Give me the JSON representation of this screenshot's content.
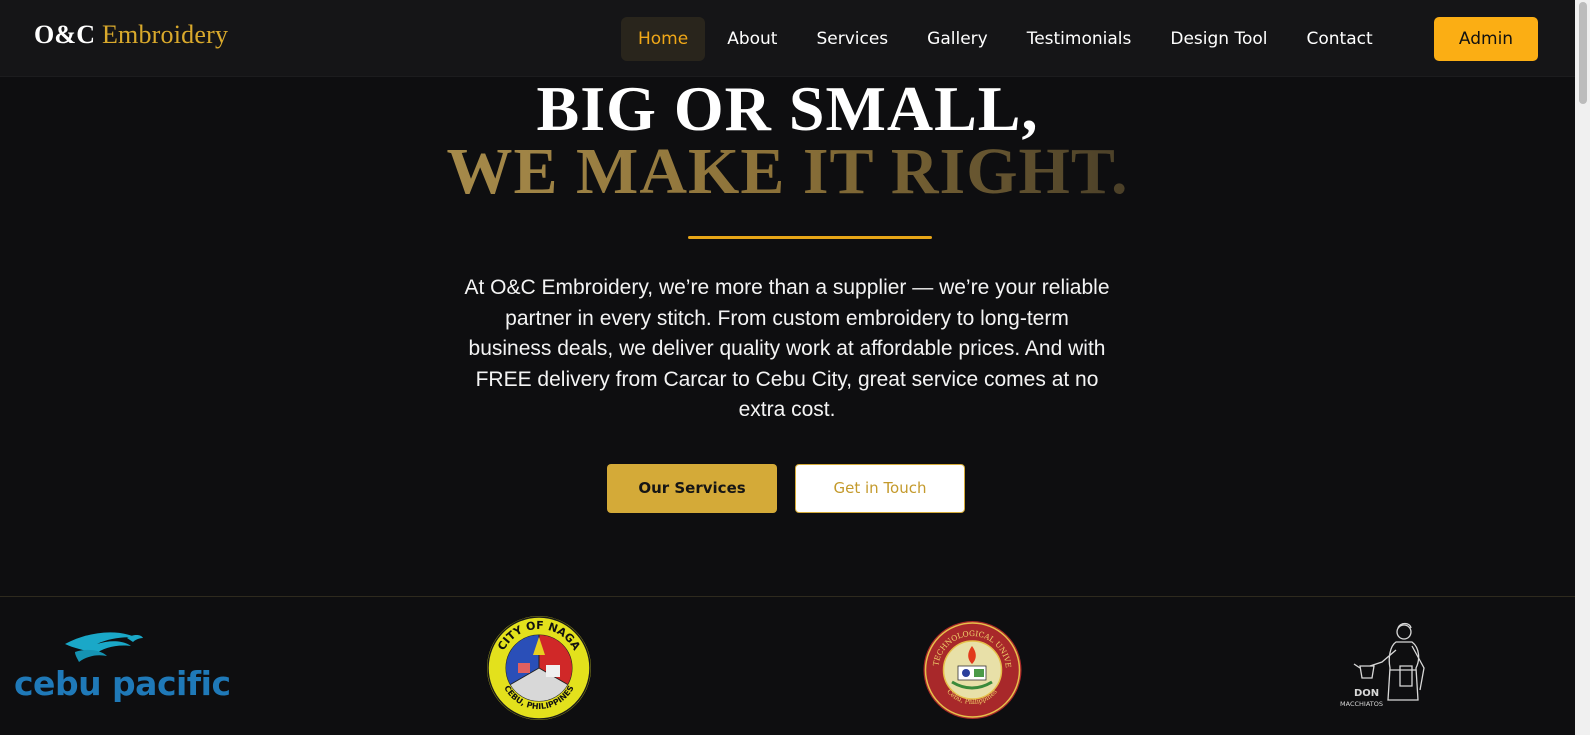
{
  "brand": {
    "part1": "O&C",
    "part2": "Embroidery"
  },
  "nav": {
    "items": [
      {
        "label": "Home",
        "active": true
      },
      {
        "label": "About"
      },
      {
        "label": "Services"
      },
      {
        "label": "Gallery"
      },
      {
        "label": "Testimonials"
      },
      {
        "label": "Design Tool"
      },
      {
        "label": "Contact"
      }
    ],
    "admin_label": "Admin"
  },
  "hero": {
    "line1": "BIG OR SMALL,",
    "line2": "WE MAKE IT RIGHT.",
    "description": "At O&C Embroidery, we’re more than a supplier — we’re your reliable partner in every stitch. From custom embroidery to long-term business deals, we deliver quality work at affordable prices. And with FREE delivery from Carcar to Cebu City, great service comes at no extra cost.",
    "primary_button": "Our Services",
    "secondary_button": "Get in Touch"
  },
  "clients": {
    "cebu_pacific": "cebu pacific",
    "naga_seal_top": "CITY OF NAGA",
    "naga_seal_bottom": "CEBU, PHILIPPINES",
    "ctu_seal_top": "CEBU TECHNOLOGICAL UNIVERSITY",
    "ctu_seal_bottom": "Cebu, Philippines",
    "don_name": "DON",
    "don_sub": "MACCHIATOS"
  },
  "colors": {
    "background": "#0e0e10",
    "navbar": "#151517",
    "accent_gold": "#d4aa38",
    "admin_orange": "#fbae14",
    "active_nav_text": "#f0a818"
  }
}
